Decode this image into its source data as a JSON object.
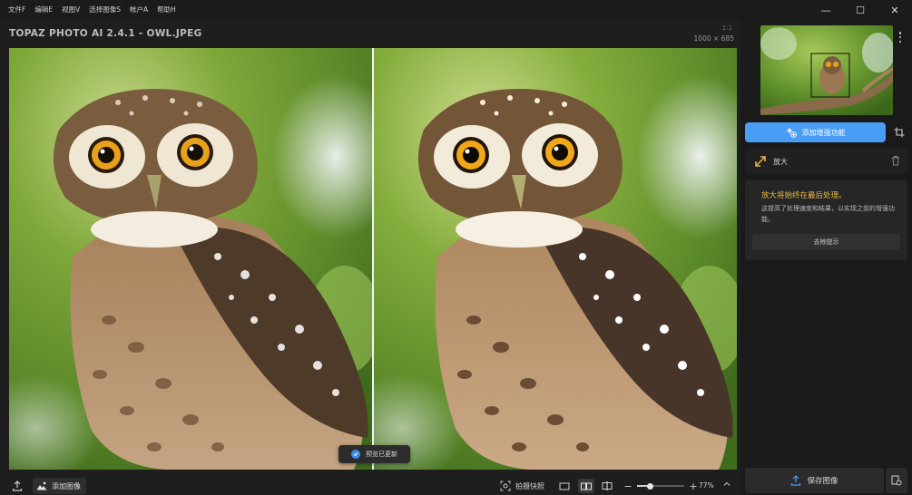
{
  "menu": {
    "items": [
      "文件F",
      "编辑E",
      "视图V",
      "选择图像S",
      "帐户A",
      "帮助H"
    ]
  },
  "window_controls": {
    "minimize": "—",
    "maximize": "☐",
    "close": "✕"
  },
  "image": {
    "title": "TOPAZ PHOTO AI 2.4.1 - OWL.JPEG",
    "dimensions": "1000 × 685",
    "percent_hint": "1:1"
  },
  "toast": {
    "text": "预览已更新"
  },
  "toolbar": {
    "add_image": "添加图像",
    "snapshot": "拍摄快照",
    "zoom": {
      "value_text": "77%",
      "level": 0.28
    }
  },
  "sidebar": {
    "add_enhancement": "添加增强功能",
    "upscale_label": "放大",
    "notice": {
      "title": "放大将始终在最后处理。",
      "body": "这提高了处理速度和结果，以实现之前的增强功能。",
      "dismiss": "去除提示"
    },
    "save": "保存图像"
  },
  "colors": {
    "accent": "#4a9df5",
    "notice_title": "#e8b64a",
    "background": "#1e1e1e"
  },
  "icons": {
    "export": "upload-icon",
    "add_image": "mountain-image-icon",
    "snapshot": "camera-frame-icon",
    "view_single": "single-view-icon",
    "view_side": "side-by-side-icon",
    "view_split": "split-view-icon",
    "add_enhancement": "sparkle-add-icon",
    "crop": "crop-icon",
    "upscale": "diagonal-arrows-icon",
    "trash": "trash-icon",
    "save": "upload-icon",
    "save_settings": "export-settings-icon",
    "more": "vertical-dots-icon",
    "toast_check": "check-circle-icon"
  }
}
